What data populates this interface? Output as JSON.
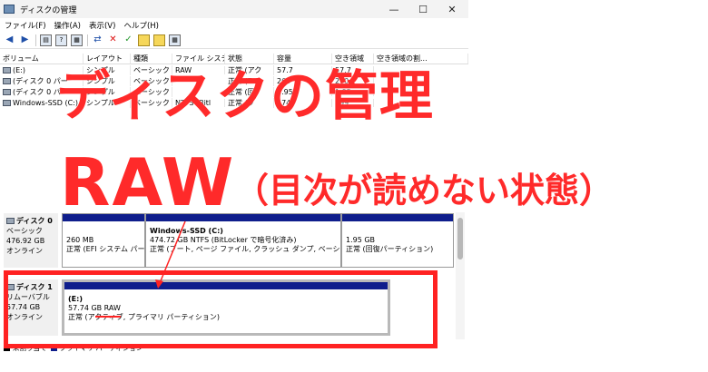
{
  "window": {
    "title": "ディスクの管理",
    "controls": [
      "—",
      "☐",
      "✕"
    ]
  },
  "menu": [
    "ファイル(F)",
    "操作(A)",
    "表示(V)",
    "ヘルプ(H)"
  ],
  "volume_table": {
    "headers": [
      "ボリューム",
      "レイアウト",
      "種類",
      "ファイル システム",
      "状態",
      "容量",
      "空き領域",
      "空き領域の割..."
    ],
    "rows": [
      [
        "(E:)",
        "シンプル",
        "ベーシック",
        "RAW",
        "正常 (アク",
        "57.7",
        "57.7",
        ""
      ],
      [
        "(ディスク 0 パー",
        "シンプル",
        "ベーシック",
        "",
        "正常 (E",
        "260",
        "260",
        ""
      ],
      [
        "(ディスク 0 パー",
        "シンプル",
        "ベーシック",
        "",
        "正常 (回",
        "1.95",
        "1.95",
        ""
      ],
      [
        "Windows-SSD (C:)",
        "シンプル",
        "ベーシック",
        "NTFS (Bitl",
        "正常 (ブ",
        "474",
        "299",
        ""
      ]
    ]
  },
  "overlay": {
    "line1": "ディスクの管理",
    "line2_main": "RAW",
    "line2_paren": "（目次が読めない状態）"
  },
  "disks": [
    {
      "name": "ディスク 0",
      "type": "ベーシック",
      "size": "476.92 GB",
      "status": "オンライン",
      "partitions": [
        {
          "name": "",
          "size": "260 MB",
          "status": "正常 (EFI システム パーティ"
        },
        {
          "name": "Windows-SSD  (C:)",
          "size": "474.72 GB NTFS (BitLocker で暗号化済み)",
          "status": "正常 (ブート, ページ ファイル, クラッシュ ダンプ, ベーシック データ パー"
        },
        {
          "name": "",
          "size": "1.95 GB",
          "status": "正常 (回復パーティション)"
        }
      ]
    },
    {
      "name": "ディスク 1",
      "type": "リムーバブル",
      "size": "57.74 GB",
      "status": "オンライン",
      "partitions": [
        {
          "name": "(E:)",
          "size": "57.74 GB RAW",
          "status": "正常 (アクティブ, プライマリ パーティション)"
        }
      ]
    }
  ],
  "legend": [
    {
      "label": "未割り当て",
      "color": "#000000"
    },
    {
      "label": "プライマリ パーティション",
      "color": "#0f1e8c"
    }
  ],
  "colors": {
    "accent_red": "#ff2a2a",
    "partition_bar": "#0f1e8c"
  }
}
